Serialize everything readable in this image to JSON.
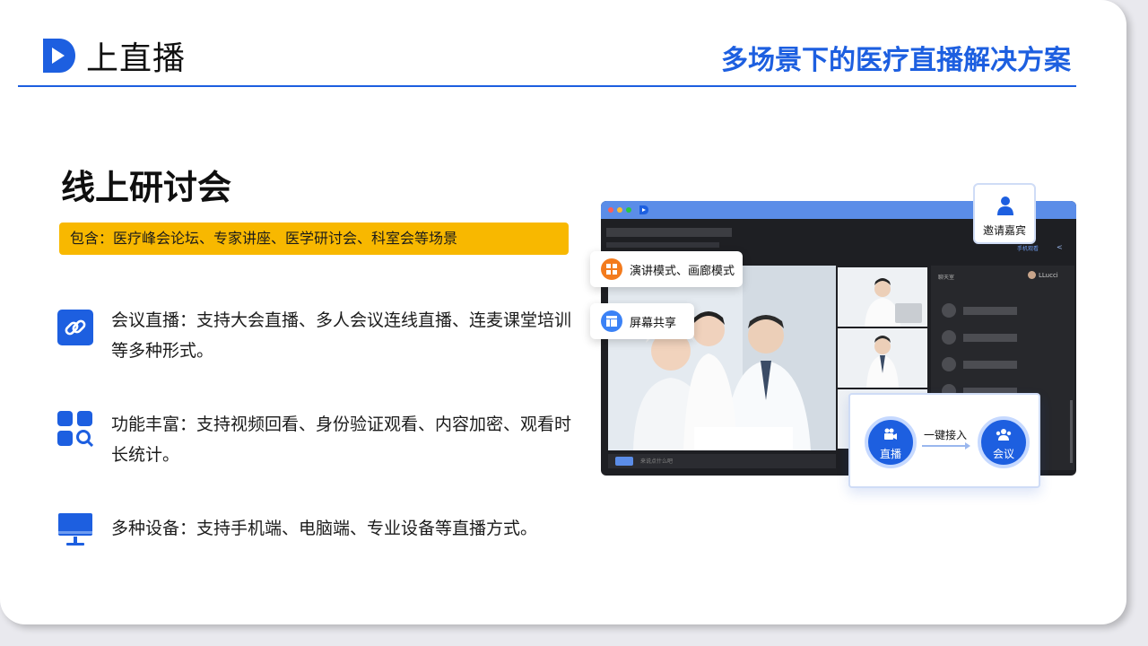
{
  "brand": {
    "name": "上直播",
    "logo_icon": "play-logo-icon",
    "color": "#1d5fe0"
  },
  "header": {
    "title": "多场景下的医疗直播解决方案"
  },
  "section": {
    "title": "线上研讨会",
    "tag": "包含：医疗峰会论坛、专家讲座、医学研讨会、科室会等场景"
  },
  "features": [
    {
      "icon": "link-icon",
      "text": "会议直播：支持大会直播、多人会议连线直播、连麦课堂培训等多种形式。"
    },
    {
      "icon": "grid-search-icon",
      "text": "功能丰富：支持视频回看、身份验证观看、内容加密、观看时长统计。"
    },
    {
      "icon": "monitor-icon",
      "text": "多种设备：支持手机端、电脑端、专业设备等直播方式。"
    }
  ],
  "mockup": {
    "modes_label": "演讲模式、画廊模式",
    "share_label": "屏幕共享",
    "invite_label": "邀请嘉宾",
    "chat_title": "聊天室",
    "chat_user": "LLucci",
    "phone_watch": "手机观看",
    "input_placeholder": "来说点什么吧",
    "live_label": "直播",
    "meeting_label": "会议",
    "join_label": "一键接入"
  },
  "colors": {
    "accent": "#1d5fe0",
    "tag_bg": "#f8b800",
    "orange": "#f37b1d"
  }
}
